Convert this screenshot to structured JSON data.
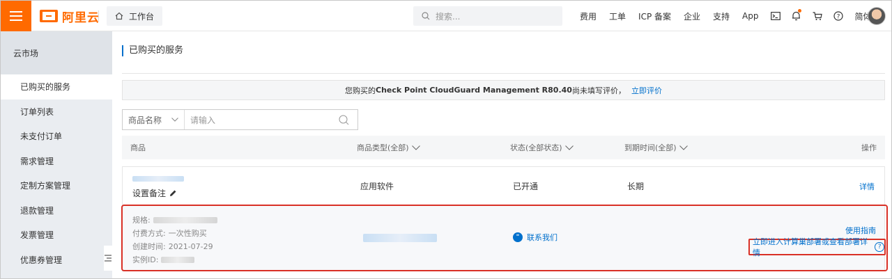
{
  "topbar": {
    "logo_text": "阿里云",
    "workbench_label": "工作台",
    "search_placeholder": "搜索...",
    "nav_items": [
      "费用",
      "工单",
      "ICP 备案",
      "企业",
      "支持",
      "App"
    ],
    "language": "简体",
    "accent_color": "#ff6a00"
  },
  "sidebar": {
    "section_title": "云市场",
    "items": [
      {
        "label": "已购买的服务",
        "active": true
      },
      {
        "label": "订单列表",
        "active": false
      },
      {
        "label": "未支付订单",
        "active": false
      },
      {
        "label": "需求管理",
        "active": false
      },
      {
        "label": "定制方案管理",
        "active": false
      },
      {
        "label": "退款管理",
        "active": false
      },
      {
        "label": "发票管理",
        "active": false
      },
      {
        "label": "优惠券管理",
        "active": false
      }
    ]
  },
  "main": {
    "page_title": "已购买的服务",
    "notice": {
      "prefix": "您购买的",
      "product": "Check Point CloudGuard Management R80.40",
      "suffix": "尚未填写评价，",
      "link": "立即评价"
    },
    "filter": {
      "select_label": "商品名称",
      "input_placeholder": "请输入"
    },
    "table": {
      "columns": {
        "product": "商品",
        "type": "商品类型(全部)",
        "status": "状态(全部状态)",
        "expire": "到期时间(全部)",
        "action": "操作"
      },
      "row": {
        "remark_label": "设置备注",
        "type": "应用软件",
        "status": "已开通",
        "expire": "长期",
        "detail_link": "详情"
      },
      "detail": {
        "spec_label": "规格:",
        "payment_label": "付费方式:",
        "payment_value": "一次性购买",
        "created_label": "创建时间:",
        "created_value": "2021-07-29",
        "instance_label": "实例ID:",
        "contact_link": "联系我们",
        "guide_link": "使用指南",
        "deploy_link": "立即进入计算巢部署或查看部署详情"
      }
    }
  },
  "colors": {
    "link": "#0070cc",
    "highlight": "#d93026"
  }
}
